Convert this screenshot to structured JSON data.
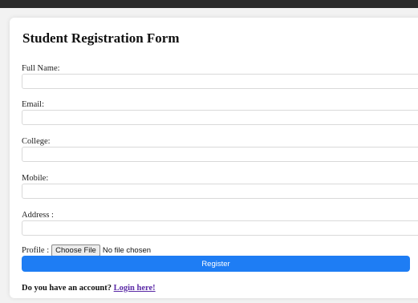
{
  "form": {
    "title": "Student Registration Form",
    "fields": [
      {
        "label": "Full Name:",
        "value": "",
        "placeholder": ""
      },
      {
        "label": "Email:",
        "value": "",
        "placeholder": ""
      },
      {
        "label": "College:",
        "value": "",
        "placeholder": ""
      },
      {
        "label": "Mobile:",
        "value": "",
        "placeholder": ""
      },
      {
        "label": "Address :",
        "value": "",
        "placeholder": ""
      }
    ],
    "profile": {
      "label": "Profile :",
      "button_label": "Choose File",
      "status": "No file chosen"
    },
    "submit_label": "Register",
    "footer": {
      "text": "Do you have an account? ",
      "link_text": "Login here!"
    },
    "colors": {
      "primary": "#1e7df4",
      "link": "#5b2aa6"
    }
  }
}
